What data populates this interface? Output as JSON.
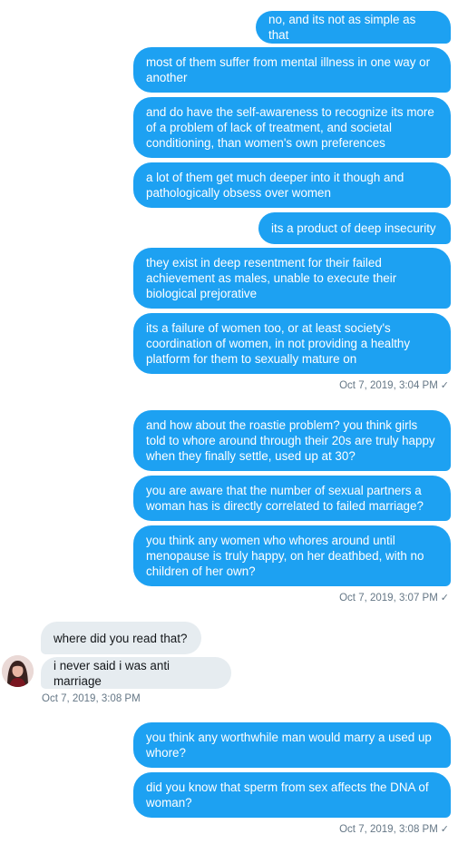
{
  "conversation": {
    "group1": {
      "messages": [
        "no, and its not as simple as that",
        "most of them suffer from mental illness in one way or another",
        "and do have the self-awareness to recognize its more of a problem of lack of treatment, and societal conditioning, than women's own preferences",
        "a lot of them get much deeper into it though and pathologically obsess over women",
        "its a product of deep insecurity",
        "they exist in deep resentment for their failed achievement as males, unable to execute their biological prejorative",
        "its a failure of women too, or at least society's coordination of women, in not providing a healthy platform for them to sexually mature on"
      ],
      "timestamp": "Oct 7, 2019, 3:04 PM"
    },
    "group2": {
      "messages": [
        "and how about the roastie problem? you think girls told to whore around through their 20s are truly happy when they finally settle, used up at 30?",
        "you are aware that the number of sexual partners a woman has is directly correlated to failed marriage?",
        "you think any women who whores around until menopause is truly happy, on her deathbed, with no children of her own?"
      ],
      "timestamp": "Oct 7, 2019, 3:07 PM"
    },
    "group3": {
      "messages": [
        "where did you read that?",
        "i never said i was anti marriage"
      ],
      "timestamp": "Oct 7, 2019, 3:08 PM"
    },
    "group4": {
      "messages": [
        "you think any worthwhile man would marry a used up whore?",
        "did you know that sperm from sex affects the DNA of woman?"
      ],
      "timestamp": "Oct 7, 2019, 3:08 PM"
    },
    "seen_icon": "checkmark-icon",
    "seen_glyph": "✓",
    "colors": {
      "outgoing_bubble": "#1da1f2",
      "incoming_bubble": "#e6ecf0",
      "timestamp": "#657786"
    }
  }
}
